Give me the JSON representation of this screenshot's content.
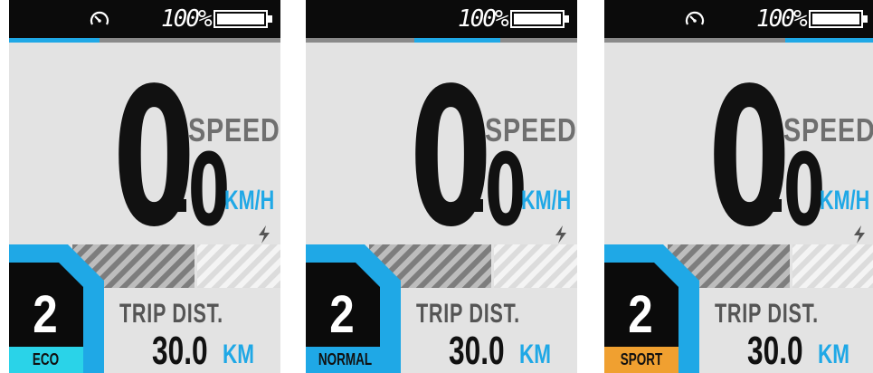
{
  "colors": {
    "accent_blue": "#1fa8e6",
    "eco_cyan": "#2ad3e8",
    "normal_blue": "#1fa8e6",
    "sport_orange": "#f0a030",
    "panel_bg": "#e3e3e3",
    "status_bar": "#0b0b0b"
  },
  "panels": [
    {
      "battery": "100%",
      "battery_level": 1.0,
      "speedometer_icon": true,
      "speed_integer": "0",
      "speed_decimal": "0",
      "speed_label": "SPEED",
      "speed_unit": "KM/H",
      "assist_level": "2",
      "mode": "ECO",
      "mode_color": "#2ad3e8",
      "trip_label": "TRIP DIST.",
      "trip_value": "30.0",
      "trip_unit": "KM",
      "icons": [
        "speedometer-icon",
        "battery-icon",
        "lightning-icon"
      ]
    },
    {
      "battery": "100%",
      "battery_level": 1.0,
      "speedometer_icon": false,
      "speed_integer": "0",
      "speed_decimal": "0",
      "speed_label": "SPEED",
      "speed_unit": "KM/H",
      "assist_level": "2",
      "mode": "NORMAL",
      "mode_color": "#1fa8e6",
      "trip_label": "TRIP DIST.",
      "trip_value": "30.0",
      "trip_unit": "KM",
      "icons": [
        "battery-icon",
        "lightning-icon"
      ]
    },
    {
      "battery": "100%",
      "battery_level": 1.0,
      "speedometer_icon": true,
      "speed_integer": "0",
      "speed_decimal": "0",
      "speed_label": "SPEED",
      "speed_unit": "KM/H",
      "assist_level": "2",
      "mode": "SPORT",
      "mode_color": "#f0a030",
      "trip_label": "TRIP DIST.",
      "trip_value": "30.0",
      "trip_unit": "KM",
      "icons": [
        "speedometer-icon",
        "battery-icon",
        "lightning-icon"
      ]
    }
  ]
}
